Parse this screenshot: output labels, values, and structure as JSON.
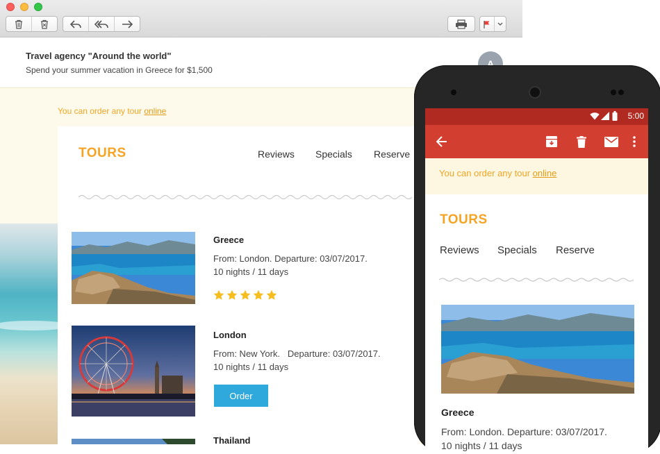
{
  "mail": {
    "from": "Travel agency \"Around the world\"",
    "subject": "Spend your summer vacation in Greece for $1,500",
    "avatar_letter": "A",
    "toolbar_icons": [
      "trash-icon",
      "junk-icon",
      "reply-icon",
      "reply-all-icon",
      "forward-icon",
      "print-icon",
      "flag-icon",
      "chevron-down-icon"
    ]
  },
  "newsletter": {
    "notice_prefix": "You can order any tour ",
    "notice_link": "online",
    "brand": "TOURS",
    "nav": [
      "Reviews",
      "Specials",
      "Reserve"
    ],
    "tours": [
      {
        "title": "Greece",
        "details": "From: London. Departure: 03/07/2017.\n10 nights / 11 days",
        "rating": 5
      },
      {
        "title": "London",
        "details": "From: New York.   Departure: 03/07/2017.\n10 nights / 11 days",
        "button": "Order"
      },
      {
        "title": "Thailand"
      }
    ]
  },
  "phone": {
    "time": "5:00",
    "appbar_icons": [
      "back-arrow-icon",
      "archive-icon",
      "delete-icon",
      "mail-icon",
      "more-vert-icon"
    ],
    "notice_prefix": "You can order any tour ",
    "notice_link": "online",
    "brand": "TOURS",
    "nav": [
      "Reviews",
      "Specials",
      "Reserve"
    ],
    "tour": {
      "title": "Greece",
      "details": "From: London. Departure: 03/07/2017.\n10 nights / 11 days"
    }
  },
  "colors": {
    "accent": "#f4a425",
    "order_button": "#2fa8dc",
    "appbar": "#d23f31",
    "statusbar": "#b02a21",
    "notice_bg": "#fdfaeb"
  }
}
